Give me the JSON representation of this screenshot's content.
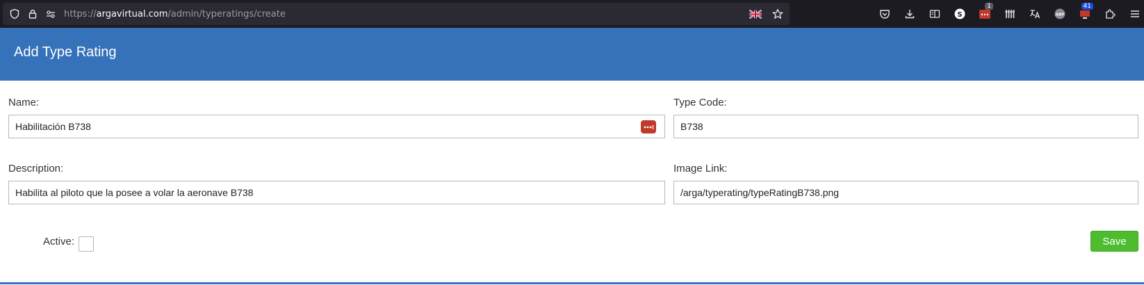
{
  "browser": {
    "url_prefix": "https://",
    "url_host": "argavirtual.com",
    "url_path": "/admin/typeratings/create",
    "badges": {
      "extension_count": "1",
      "notification_count": "41"
    },
    "icons": [
      "shield-icon",
      "lock-icon",
      "permissions-icon",
      "uk-flag-icon",
      "bookmark-star-icon",
      "pocket-icon",
      "download-icon",
      "reader-view-icon",
      "s-extension-icon",
      "password-manager-icon",
      "library-icon",
      "translate-icon",
      "adblock-icon",
      "screen-extension-icon",
      "extensions-icon",
      "menu-icon"
    ]
  },
  "page": {
    "title": "Add Type Rating"
  },
  "form": {
    "name": {
      "label": "Name:",
      "value": "Habilitación B738"
    },
    "type_code": {
      "label": "Type Code:",
      "value": "B738"
    },
    "description": {
      "label": "Description:",
      "value": "Habilita al piloto que la posee a volar la aeronave B738"
    },
    "image_link": {
      "label": "Image Link:",
      "value": "/arga/typerating/typeRatingB738.png"
    },
    "active": {
      "label": "Active:",
      "checked": false
    },
    "save_label": "Save"
  },
  "colors": {
    "header_blue": "#3572b9",
    "save_green": "#4dbd2f",
    "password_red": "#c0392b"
  }
}
